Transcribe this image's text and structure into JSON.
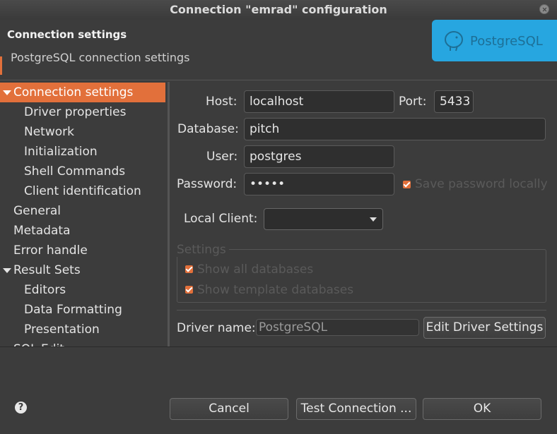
{
  "window": {
    "title": "Connection \"emrad\" configuration"
  },
  "header": {
    "title": "Connection settings",
    "subtitle": "PostgreSQL connection settings",
    "logo_text": "PostgreSQL"
  },
  "nav": {
    "items": [
      {
        "label": "Connection settings",
        "expanded": true
      },
      {
        "label": "Driver properties"
      },
      {
        "label": "Network"
      },
      {
        "label": "Initialization"
      },
      {
        "label": "Shell Commands"
      },
      {
        "label": "Client identification"
      },
      {
        "label": "General"
      },
      {
        "label": "Metadata"
      },
      {
        "label": "Error handle"
      },
      {
        "label": "Result Sets",
        "expanded": true
      },
      {
        "label": "Editors"
      },
      {
        "label": "Data Formatting"
      },
      {
        "label": "Presentation"
      },
      {
        "label": "SQL Edit..."
      }
    ]
  },
  "form": {
    "host_label": "Host:",
    "host_value": "localhost",
    "port_label": "Port:",
    "port_value": "5433",
    "database_label": "Database:",
    "database_value": "pitch",
    "user_label": "User:",
    "user_value": "postgres",
    "password_label": "Password:",
    "password_value": "•••••",
    "save_password_label": "Save password locally",
    "save_password_checked": true,
    "local_client_label": "Local Client:",
    "local_client_value": "",
    "settings_group_label": "Settings",
    "show_all_db_label": "Show all databases",
    "show_all_db_checked": true,
    "show_template_db_label": "Show template databases",
    "show_template_db_checked": true,
    "driver_name_label": "Driver name:",
    "driver_name_value": "PostgreSQL",
    "edit_driver_label": "Edit Driver Settings"
  },
  "footer": {
    "help_icon": "?",
    "cancel_label": "Cancel",
    "test_label": "Test Connection ...",
    "ok_label": "OK"
  },
  "colors": {
    "accent": "#e2703b",
    "background": "#3c3c3c",
    "logo_bg": "#27a6e0"
  }
}
